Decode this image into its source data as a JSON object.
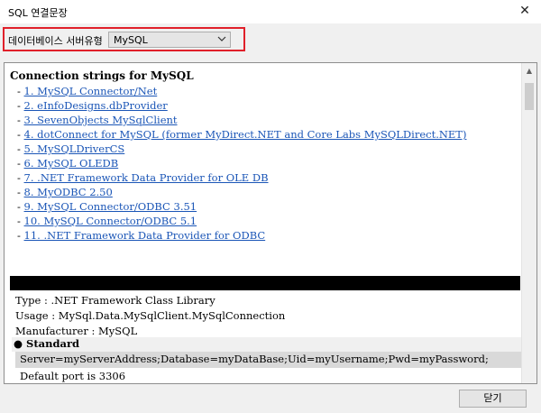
{
  "window": {
    "title": "SQL 연결문장",
    "close_glyph": "✕"
  },
  "db_type": {
    "label": "데이터베이스 서버유형",
    "selected": "MySQL",
    "chevron_icon": "chevron-down-icon"
  },
  "content": {
    "heading": "Connection strings for MySQL",
    "links": [
      "1. MySQL Connector/Net",
      "2. eInfoDesigns.dbProvider",
      "3. SevenObjects MySqlClient",
      "4. dotConnect for MySQL (former MyDirect.NET and Core Labs MySQLDirect.NET)",
      "5. MySQLDriverCS",
      "6. MySQL OLEDB",
      "7. .NET Framework Data Provider for OLE DB",
      "8. MyODBC 2.50",
      "9. MySQL Connector/ODBC 3.51",
      "10. MySQL Connector/ODBC 5.1",
      "11. .NET Framework Data Provider for ODBC"
    ],
    "dash": "-",
    "type_line": "Type : .NET Framework Class Library",
    "usage_line": "Usage : MySql.Data.MySqlClient.MySqlConnection",
    "manufacturer_line": "Manufacturer : MySQL",
    "standard_bullet": "●",
    "standard_label": "Standard",
    "connection_string": "Server=myServerAddress;Database=myDataBase;Uid=myUsername;Pwd=myPassword;",
    "default_port": "Default port is 3306"
  },
  "buttons": {
    "close_label": "닫기"
  }
}
